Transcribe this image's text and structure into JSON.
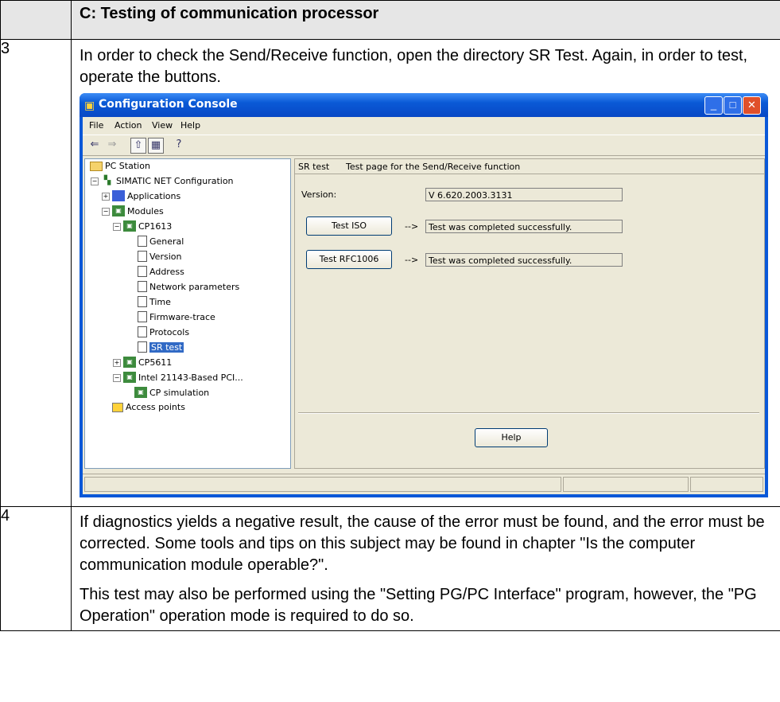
{
  "section": {
    "header": "C: Testing of communication processor"
  },
  "steps": [
    {
      "number": "3",
      "text": "In order to check the Send/Receive function, open the directory SR Test. Again, in order to test, operate the buttons."
    },
    {
      "number": "4",
      "text1": "If diagnostics yields a negative result, the cause of the error must be found, and the error must be corrected. Some tools and tips on this subject may be found in chapter \"Is the computer communication module operable?\".",
      "text2": "This test may also be performed using the \"Setting PG/PC Interface\" program, however, the \"PG Operation\" operation mode is required to do so."
    }
  ],
  "window": {
    "title": "Configuration  Console",
    "menu": [
      "File",
      "Action",
      "View",
      "Help"
    ],
    "tree": [
      {
        "label": "PC Station",
        "icon": "folder-icon"
      },
      {
        "label": "SIMATIC NET Configuration",
        "icon": "network-icon"
      },
      {
        "label": "Applications",
        "icon": "application-icon"
      },
      {
        "label": "Modules",
        "icon": "module-icon"
      },
      {
        "label": "CP1613",
        "icon": "module-icon"
      },
      {
        "label": "General",
        "icon": "page-icon"
      },
      {
        "label": "Version",
        "icon": "page-icon"
      },
      {
        "label": "Address",
        "icon": "page-icon"
      },
      {
        "label": "Network parameters",
        "icon": "page-icon"
      },
      {
        "label": "Time",
        "icon": "page-icon"
      },
      {
        "label": "Firmware-trace",
        "icon": "page-icon"
      },
      {
        "label": "Protocols",
        "icon": "page-icon"
      },
      {
        "label": "SR test",
        "icon": "page-icon"
      },
      {
        "label": "CP5611",
        "icon": "module-icon"
      },
      {
        "label": "Intel 21143-Based PCI...",
        "icon": "module-icon"
      },
      {
        "label": "CP simulation",
        "icon": "module-icon"
      },
      {
        "label": "Access points",
        "icon": "access-point-icon"
      }
    ],
    "panel": {
      "heading_name": "SR test",
      "heading_desc": "Test page for the Send/Receive function",
      "version_label": "Version:",
      "version_value": "V 6.620.2003.3131",
      "test_iso_label": "Test ISO",
      "test_iso_arrow": "-->",
      "test_iso_result": "Test was completed successfully.",
      "test_rfc_label": "Test RFC1006",
      "test_rfc_arrow": "-->",
      "test_rfc_result": "Test was completed successfully.",
      "help_label": "Help"
    },
    "controls": {
      "minimize": "_",
      "maximize": "□",
      "close": "✕"
    }
  }
}
